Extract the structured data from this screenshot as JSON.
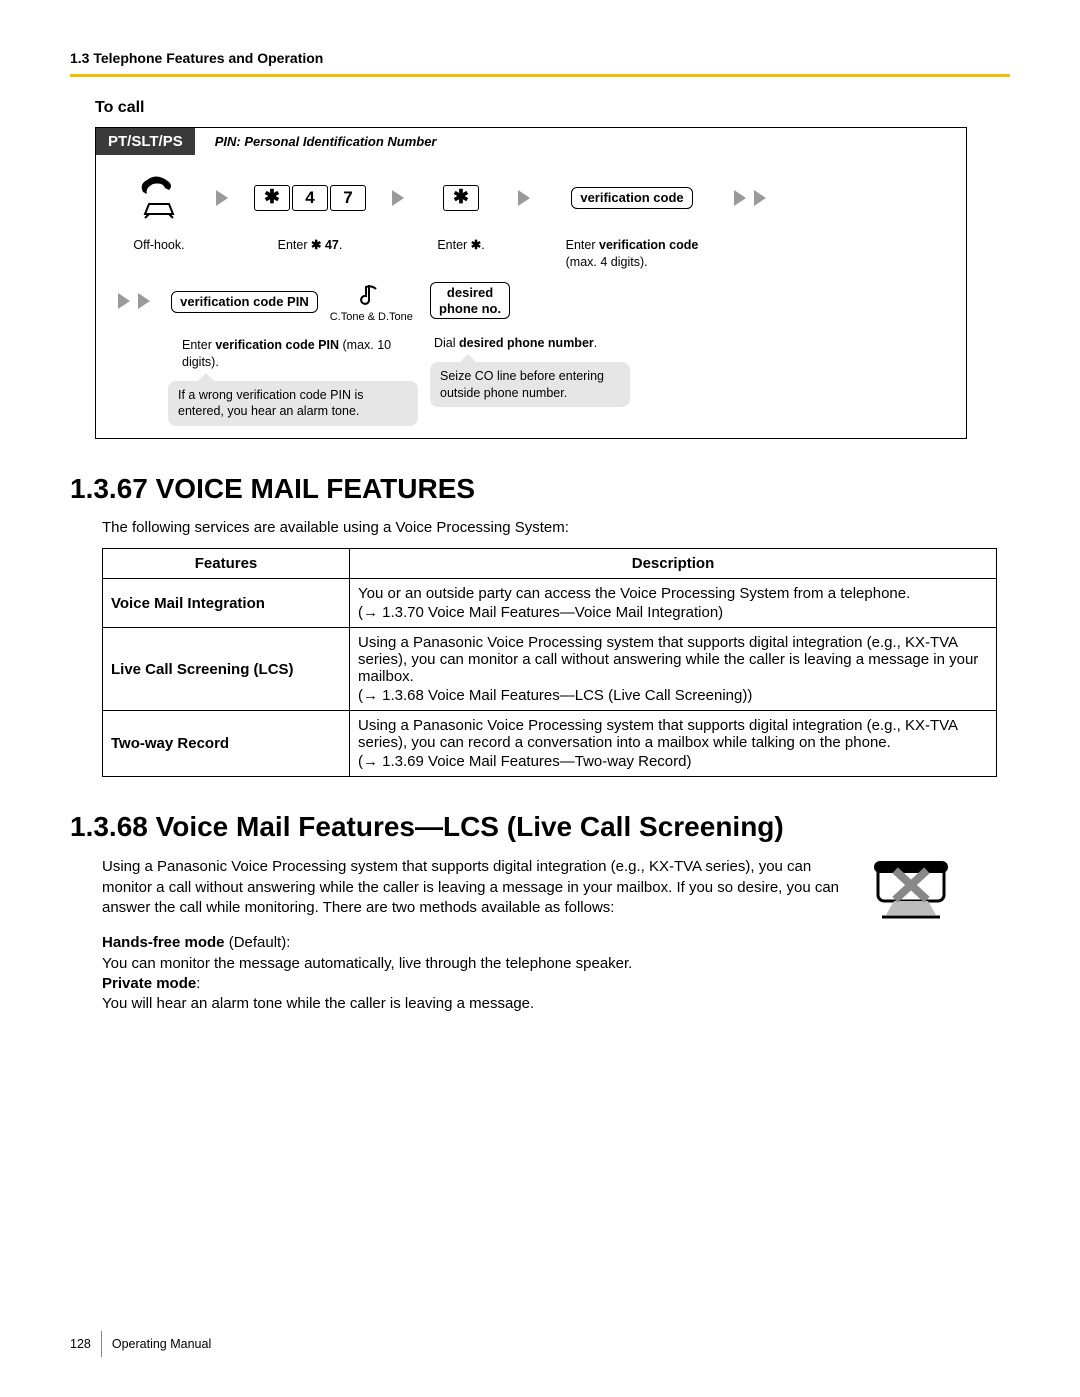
{
  "header": {
    "breadcrumb": "1.3 Telephone Features and Operation"
  },
  "tocall": {
    "title": "To call",
    "tag": "PT/SLT/PS",
    "pin_note": "PIN: Personal Identification Number",
    "row1": {
      "offhook_caption": "Off-hook.",
      "keys1": [
        "✱",
        "4",
        "7"
      ],
      "caption1_prefix": "Enter ",
      "caption1_bold": "✱ 47",
      "caption1_suffix": ".",
      "key_star": "✱",
      "caption2_prefix": "Enter ",
      "caption2_bold": "✱",
      "caption2_suffix": ".",
      "pill_vcode": "verification code",
      "caption3_prefix": "Enter ",
      "caption3_bold": "verification code",
      "caption3_extra": "(max. 4 digits)."
    },
    "row2": {
      "pill_pin": "verification code PIN",
      "tone_label": "C.Tone & D.Tone",
      "pill_phone_l1": "desired",
      "pill_phone_l2": "phone no.",
      "caption_pin_prefix": "Enter ",
      "caption_pin_bold": "verification code PIN",
      "caption_pin_extra": " (max. 10 digits).",
      "caption_dial_prefix": "Dial ",
      "caption_dial_bold": "desired phone number",
      "caption_dial_suffix": ".",
      "callout_pin": "If a wrong verification code PIN is entered, you hear an alarm tone.",
      "callout_phone": "Seize CO line before entering outside phone number."
    }
  },
  "section67": {
    "heading": "1.3.67  VOICE MAIL FEATURES",
    "intro": "The following services are available using a Voice Processing System:",
    "th_features": "Features",
    "th_desc": "Description",
    "rows": [
      {
        "feat": "Voice Mail Integration",
        "desc": "You or an outside party can access the Voice Processing System from a telephone.",
        "ref": "(→ 1.3.70 Voice Mail Features—Voice Mail Integration)"
      },
      {
        "feat": "Live Call Screening (LCS)",
        "desc": "Using a Panasonic Voice Processing system that supports digital integration (e.g., KX-TVA series), you can monitor a call without answering while the caller is leaving a message in your mailbox.",
        "ref": "(→ 1.3.68 Voice Mail Features—LCS (Live Call Screening))"
      },
      {
        "feat": "Two-way Record",
        "desc": "Using a Panasonic Voice Processing system that supports digital integration (e.g., KX-TVA series), you can record a conversation into a mailbox while talking on the phone.",
        "ref": "(→ 1.3.69 Voice Mail Features—Two-way Record)"
      }
    ]
  },
  "section68": {
    "heading": "1.3.68  Voice Mail Features—LCS (Live Call Screening)",
    "body": "Using a Panasonic Voice Processing system that supports digital integration (e.g., KX-TVA series), you can monitor a call without answering while the caller is leaving a message in your mailbox. If you so desire, you can answer the call while monitoring. There are two methods available as follows:",
    "mode1_label": "Hands-free mode",
    "mode1_default": " (Default):",
    "mode1_body": "You can monitor the message automatically, live through the telephone speaker.",
    "mode2_label": "Private mode",
    "mode2_colon": ":",
    "mode2_body": "You will hear an alarm tone while the caller is leaving a message."
  },
  "footer": {
    "page": "128",
    "doc": "Operating Manual"
  }
}
